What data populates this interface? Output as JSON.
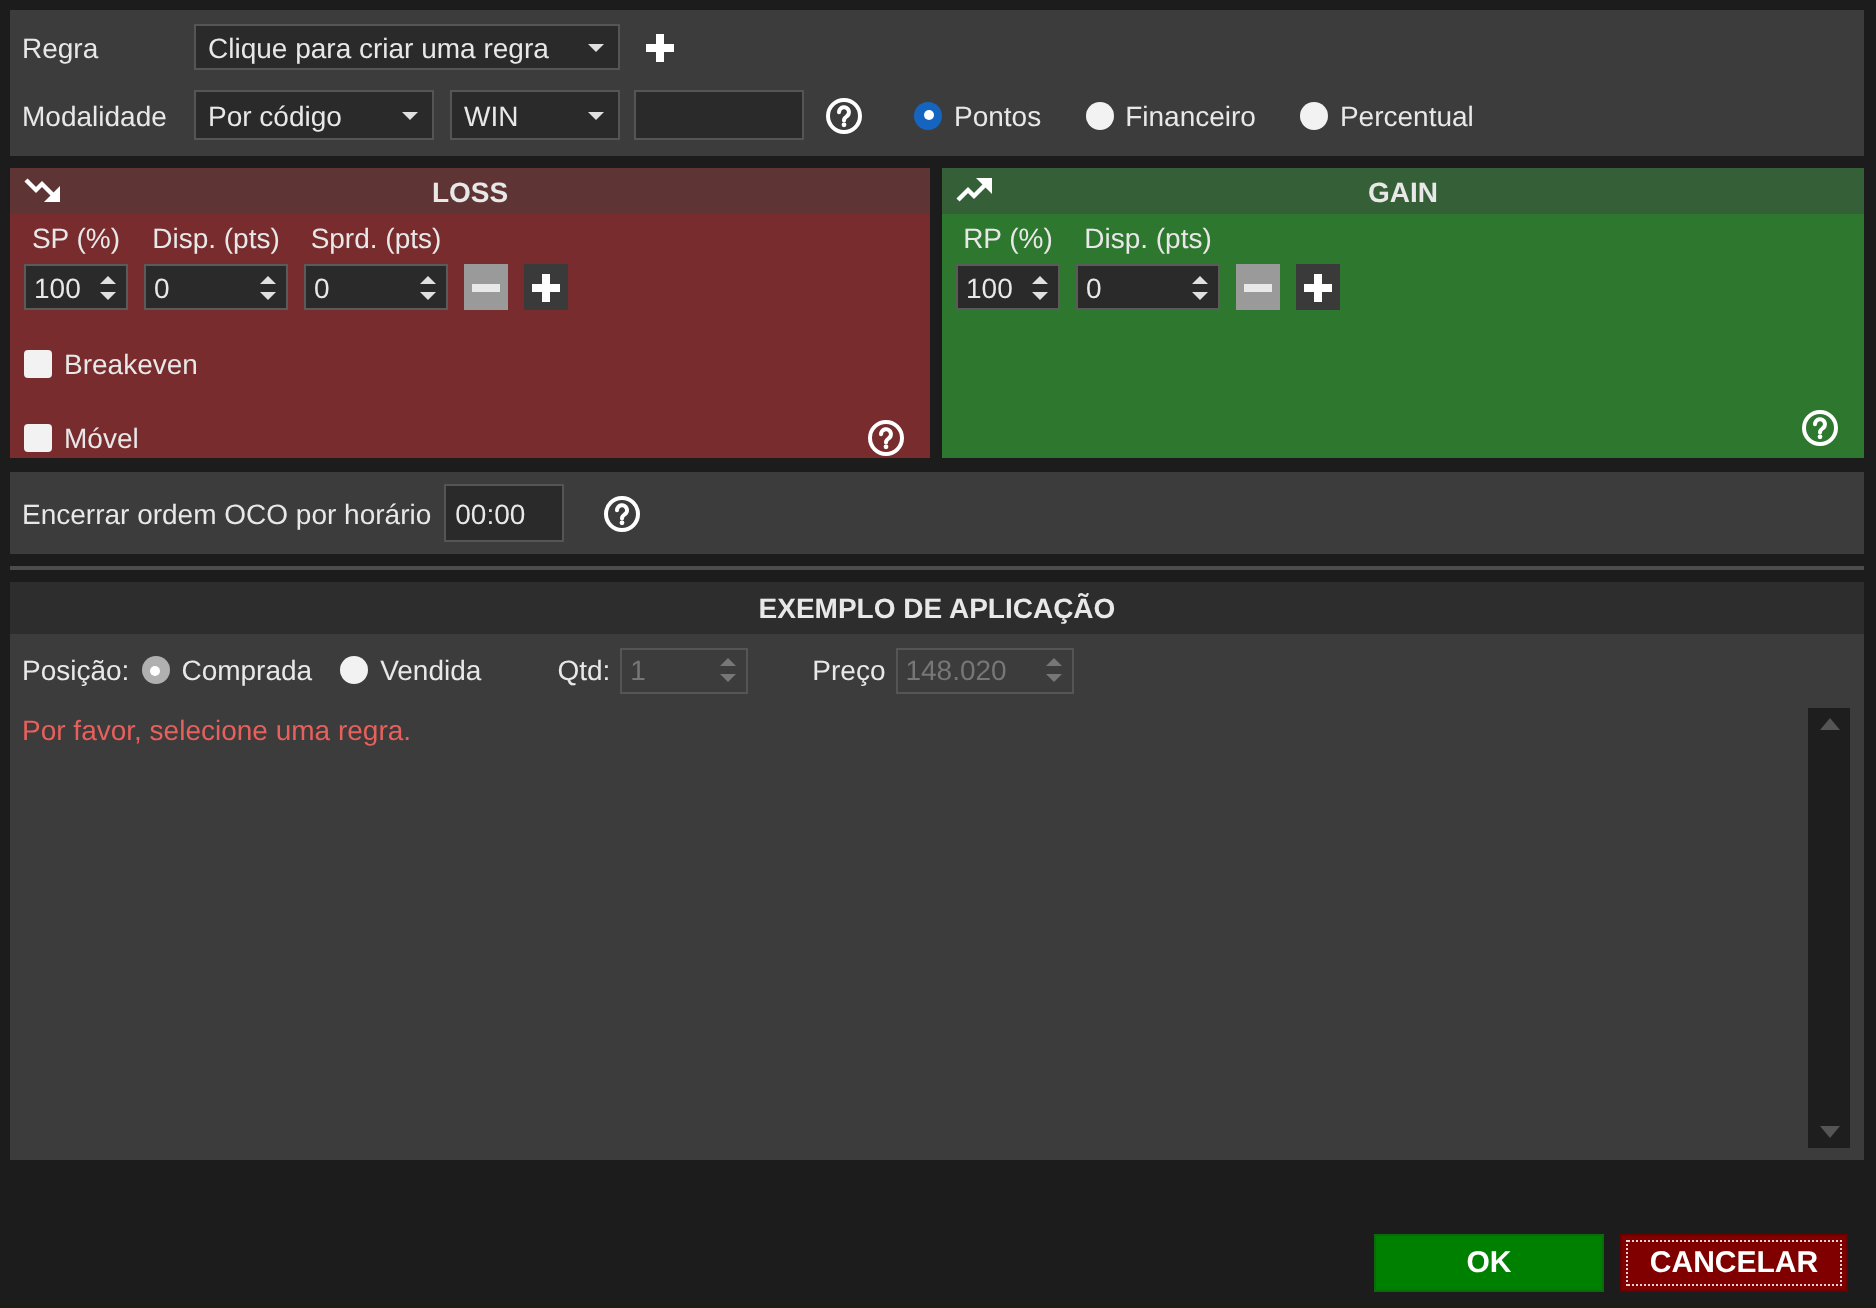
{
  "rule": {
    "label": "Regra",
    "value": "Clique para criar uma regra"
  },
  "modality": {
    "label": "Modalidade",
    "mode": "Por código",
    "asset": "WIN"
  },
  "unit_options": [
    {
      "label": "Pontos",
      "selected": true
    },
    {
      "label": "Financeiro",
      "selected": false
    },
    {
      "label": "Percentual",
      "selected": false
    }
  ],
  "loss": {
    "title": "LOSS",
    "fields": [
      {
        "label": "SP (%)",
        "value": "100"
      },
      {
        "label": "Disp. (pts)",
        "value": "0"
      },
      {
        "label": "Sprd. (pts)",
        "value": "0"
      }
    ],
    "remove_disabled": true,
    "options": [
      {
        "label": "Breakeven",
        "checked": false
      },
      {
        "label": "Móvel",
        "checked": false
      }
    ]
  },
  "gain": {
    "title": "GAIN",
    "fields": [
      {
        "label": "RP (%)",
        "value": "100"
      },
      {
        "label": "Disp. (pts)",
        "value": "0"
      }
    ],
    "remove_disabled": true
  },
  "oco": {
    "label": "Encerrar ordem OCO por horário",
    "value": "00:00"
  },
  "example": {
    "title": "EXEMPLO DE APLICAÇÃO",
    "position_label": "Posição:",
    "positions": [
      {
        "label": "Comprada",
        "selected": true
      },
      {
        "label": "Vendida",
        "selected": false
      }
    ],
    "quantity": {
      "label": "Qtd:",
      "value": "1",
      "disabled": true
    },
    "price": {
      "label": "Preço",
      "value": "148.020",
      "disabled": true
    },
    "message": "Por favor, selecione uma regra."
  },
  "buttons": [
    {
      "label": "OK",
      "kind": "confirm",
      "focused": false
    },
    {
      "label": "CANCELAR",
      "kind": "cancel",
      "focused": true
    }
  ]
}
